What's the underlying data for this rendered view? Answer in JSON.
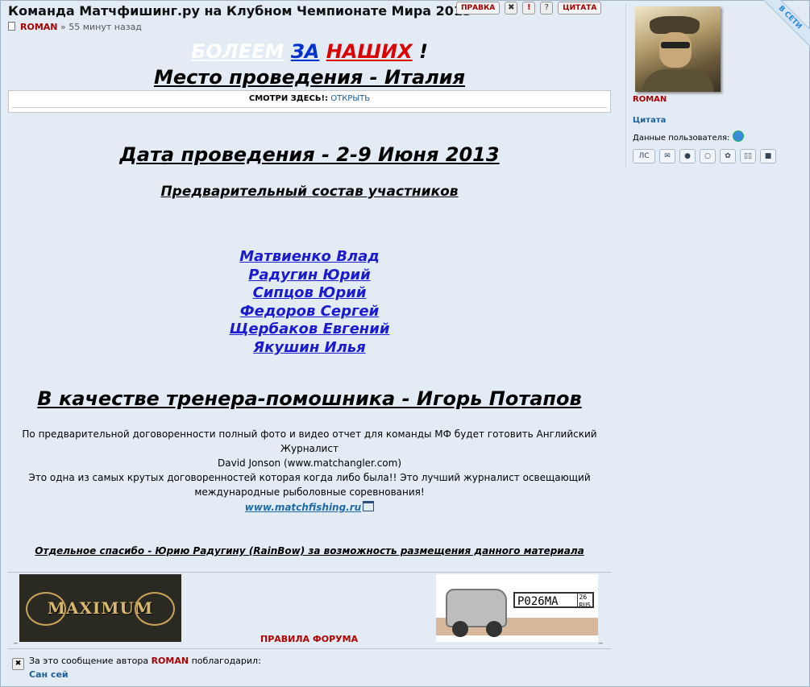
{
  "post": {
    "title": "Команда Матчфишинг.ру на Клубном Чемпионате Мира 2013",
    "author": "ROMAN",
    "separator": "»",
    "time": "55 минут назад"
  },
  "toolbar": {
    "edit_label": "ПРАВКА",
    "delete_glyph": "✖",
    "report_glyph": "!",
    "help_glyph": "?",
    "quote_label": "ЦИТАТА"
  },
  "content": {
    "cheer": {
      "w1": "БОЛЕЕМ",
      "w2": "ЗА",
      "w3": "НАШИХ",
      "w4": "!"
    },
    "place": "Место проведения - Италия",
    "spoiler": {
      "label": "СМОТРИ ЗДЕСЬ!:",
      "open": "ОТКРЫТЬ"
    },
    "date": "Дата проведения - 2-9 Июня 2013",
    "prelim": "Предварительный состав участников",
    "players": [
      "Матвиенко Влад",
      "Радугин Юрий",
      "Сипцов Юрий",
      "Федоров Сергей",
      "Щербаков Евгений",
      "Якушин Илья"
    ],
    "coach": "В качестве тренера-помошника - Игорь Потапов",
    "para1": "По предварительной договоренности полный фото и видео отчет для команды МФ будет готовить Английский Журналист",
    "para2": "David Jonson (www.matchangler.com)",
    "para3": "Это одна из самых крутых договоренностей которая когда либо была!! Это лучший журналист освещающий",
    "para4": "международные рыболовные соревнования!",
    "link": "www.matchfishing.ru",
    "thanks_line": "Отдельное спасибо - Юрию Радугину (RainBow) за возможность размещения данного материала"
  },
  "signature": {
    "logo_text": "MAXIMUM",
    "rules": "ПРАВИЛА ФОРУМА",
    "plate_number": "Р026МА",
    "plate_region": "26",
    "plate_country": "RUS",
    "underscore": "_"
  },
  "thanks": {
    "prefix": "За это сообщение автора",
    "author": "ROMAN",
    "suffix": "поблагодарил:",
    "users": "Сан сей"
  },
  "sidebar": {
    "name": "ROMAN",
    "online": "В СЕТИ",
    "quote": "Цитата",
    "user_data": "Данные пользователя:",
    "icons": [
      {
        "name": "pm-icon",
        "label": "ЛС"
      },
      {
        "name": "email-icon",
        "label": "✉"
      },
      {
        "name": "website-icon",
        "label": "●"
      },
      {
        "name": "skype-icon",
        "label": "○"
      },
      {
        "name": "icq-icon",
        "label": "✿"
      },
      {
        "name": "journal-icon",
        "label": "▯▯"
      },
      {
        "name": "gallery-icon",
        "label": "■"
      }
    ]
  }
}
